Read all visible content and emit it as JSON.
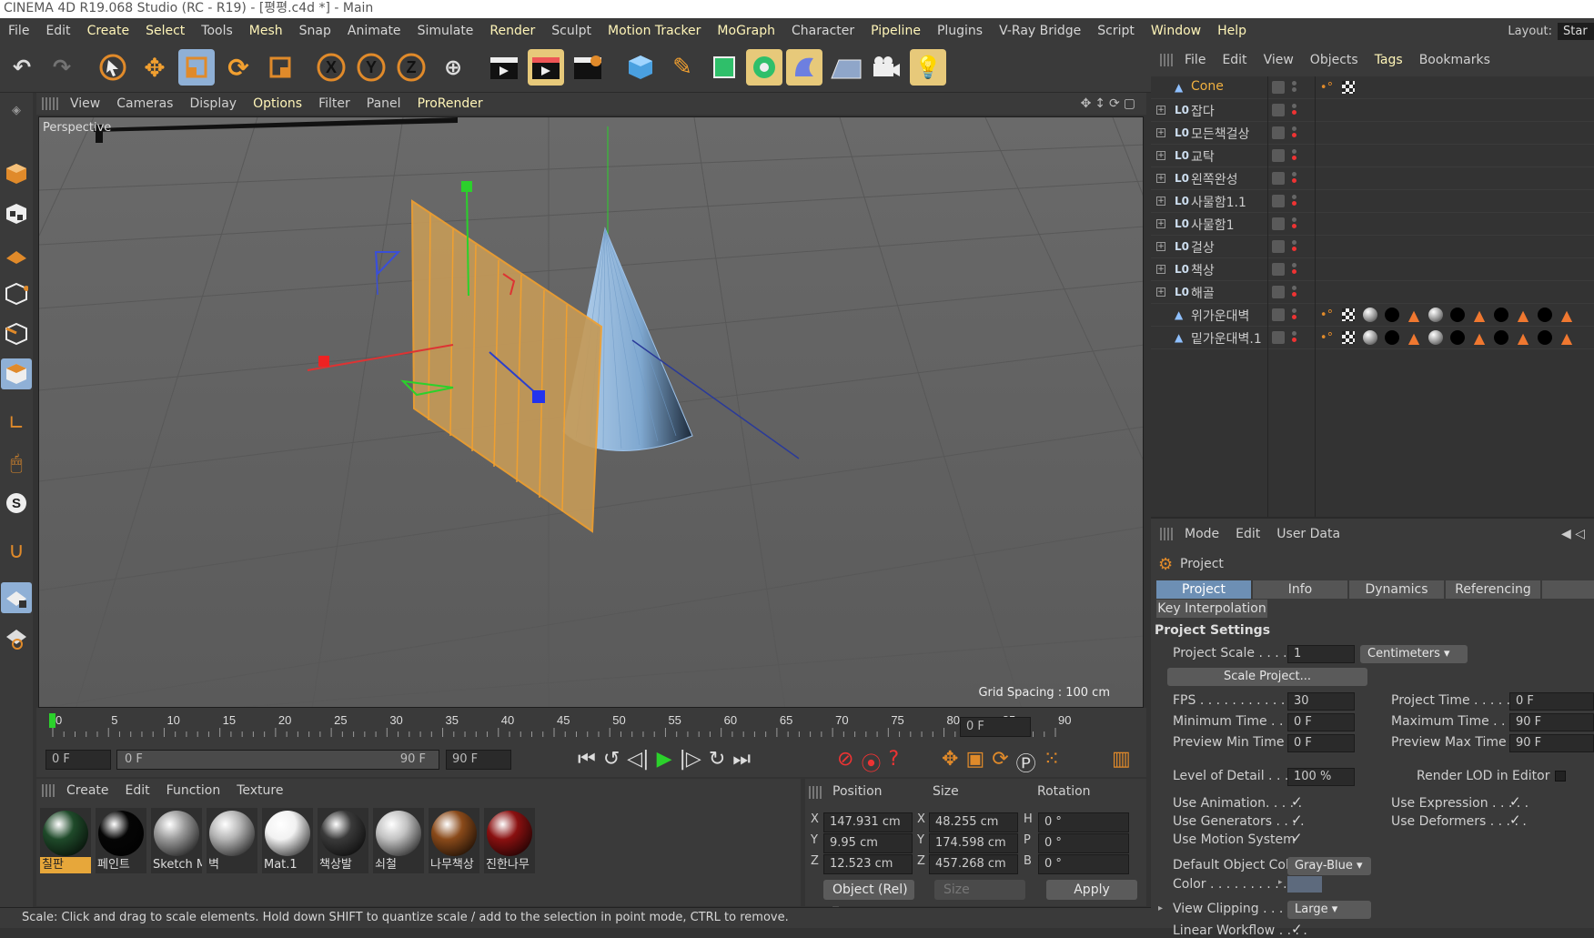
{
  "title": "CINEMA 4D R19.068 Studio (RC - R19) - [평평.c4d *] - Main",
  "menu": [
    "File",
    "Edit",
    "Create",
    "Select",
    "Tools",
    "Mesh",
    "Snap",
    "Animate",
    "Simulate",
    "Render",
    "Sculpt",
    "Motion Tracker",
    "MoGraph",
    "Character",
    "Pipeline",
    "Plugins",
    "V-Ray Bridge",
    "Script",
    "Window",
    "Help"
  ],
  "layout": {
    "label": "Layout:",
    "value": "Star"
  },
  "viewport": {
    "menu": [
      "View",
      "Cameras",
      "Display",
      "Options",
      "Filter",
      "Panel",
      "ProRender"
    ],
    "label": "Perspective",
    "grid_spacing": "Grid Spacing : 100 cm"
  },
  "timeline": {
    "ticks": [
      "0",
      "5",
      "10",
      "15",
      "20",
      "25",
      "30",
      "35",
      "40",
      "45",
      "50",
      "55",
      "60",
      "65",
      "70",
      "75",
      "80",
      "85",
      "90"
    ],
    "frame_field": "0 F",
    "start": "0 F",
    "slider_start": "0 F",
    "slider_end": "90 F",
    "end": "90 F"
  },
  "materials": {
    "menu": [
      "Create",
      "Edit",
      "Function",
      "Texture"
    ],
    "items": [
      {
        "label": "칠판",
        "color": "#1f4a2a"
      },
      {
        "label": "페인트",
        "color": "#050505"
      },
      {
        "label": "Sketch M",
        "color": "#9a9a9a"
      },
      {
        "label": "벽",
        "color": "#b5b5b5"
      },
      {
        "label": "Mat.1",
        "color": "#f2f2f2"
      },
      {
        "label": "책상발",
        "color": "#3a3a3a"
      },
      {
        "label": "쇠철",
        "color": "#c2c2c2"
      },
      {
        "label": "나무책상",
        "color": "#8a4a1a"
      },
      {
        "label": "진한나무",
        "color": "#8a1010"
      }
    ]
  },
  "coords": {
    "headers": [
      "Position",
      "Size",
      "Rotation"
    ],
    "rows": [
      {
        "axis": "X",
        "pos": "147.931 cm",
        "size_axis": "X",
        "size": "48.255 cm",
        "rot_axis": "H",
        "rot": "0 °"
      },
      {
        "axis": "Y",
        "pos": "9.95 cm",
        "size_axis": "Y",
        "size": "174.598 cm",
        "rot_axis": "P",
        "rot": "0 °"
      },
      {
        "axis": "Z",
        "pos": "12.523 cm",
        "size_axis": "Z",
        "size": "457.268 cm",
        "rot_axis": "B",
        "rot": "0 °"
      }
    ],
    "mode": "Object (Rel)",
    "size_mode": "Size",
    "apply": "Apply"
  },
  "status": "Scale: Click and drag to scale elements. Hold down SHIFT to quantize scale / add to the selection in point mode, CTRL to remove.",
  "objects": {
    "menu": [
      "File",
      "Edit",
      "View",
      "Objects",
      "Tags",
      "Bookmarks"
    ],
    "items": [
      {
        "name": "Cone",
        "type": "cone",
        "active": true
      },
      {
        "name": "잡다",
        "type": "null"
      },
      {
        "name": "모든책걸상",
        "type": "null"
      },
      {
        "name": "교탁",
        "type": "null"
      },
      {
        "name": "왼쪽완성",
        "type": "null"
      },
      {
        "name": "사물함1.1",
        "type": "null"
      },
      {
        "name": "사물함1",
        "type": "null"
      },
      {
        "name": "걸상",
        "type": "null"
      },
      {
        "name": "책상",
        "type": "null"
      },
      {
        "name": "해골",
        "type": "null"
      },
      {
        "name": "위가운대벽",
        "type": "cone"
      },
      {
        "name": "밑가운대벽.1",
        "type": "cone"
      }
    ]
  },
  "attributes": {
    "menu": [
      "Mode",
      "Edit",
      "User Data"
    ],
    "object": "Project",
    "tabs": [
      "Project Settings",
      "Info",
      "Dynamics",
      "Referencing",
      "Key Interpolation"
    ],
    "section": "Project Settings",
    "project_scale": {
      "label": "Project Scale . . . . . .",
      "value": "1",
      "unit": "Centimeters"
    },
    "scale_button": "Scale Project...",
    "left": [
      {
        "label": "FPS . . . . . . . . . . . . . .",
        "value": "30"
      },
      {
        "label": "Minimum Time . . . .",
        "value": "0 F"
      },
      {
        "label": "Preview Min Time . .",
        "value": "0 F"
      }
    ],
    "right": [
      {
        "label": "Project Time . . . . . . .",
        "value": "0 F"
      },
      {
        "label": "Maximum Time . . . . .",
        "value": "90 F"
      },
      {
        "label": "Preview Max Time . . .",
        "value": "90 F"
      }
    ],
    "lod": {
      "label": "Level of Detail . . . . .",
      "value": "100 %",
      "render_label": "Render LOD in Editor"
    },
    "checks_left": [
      "Use Animation. . . . .",
      "Use Generators . . . .",
      "Use Motion System"
    ],
    "checks_right": [
      "Use Expression . . . . .",
      "Use Deformers . . . . ."
    ],
    "default_color": {
      "label": "Default Object Color",
      "value": "Gray-Blue"
    },
    "color_label": "Color . . . . . . . . . .",
    "view_clipping": {
      "label": "View Clipping . . . . .",
      "value": "Large"
    },
    "linear_workflow": "Linear Workflow . . . ."
  }
}
